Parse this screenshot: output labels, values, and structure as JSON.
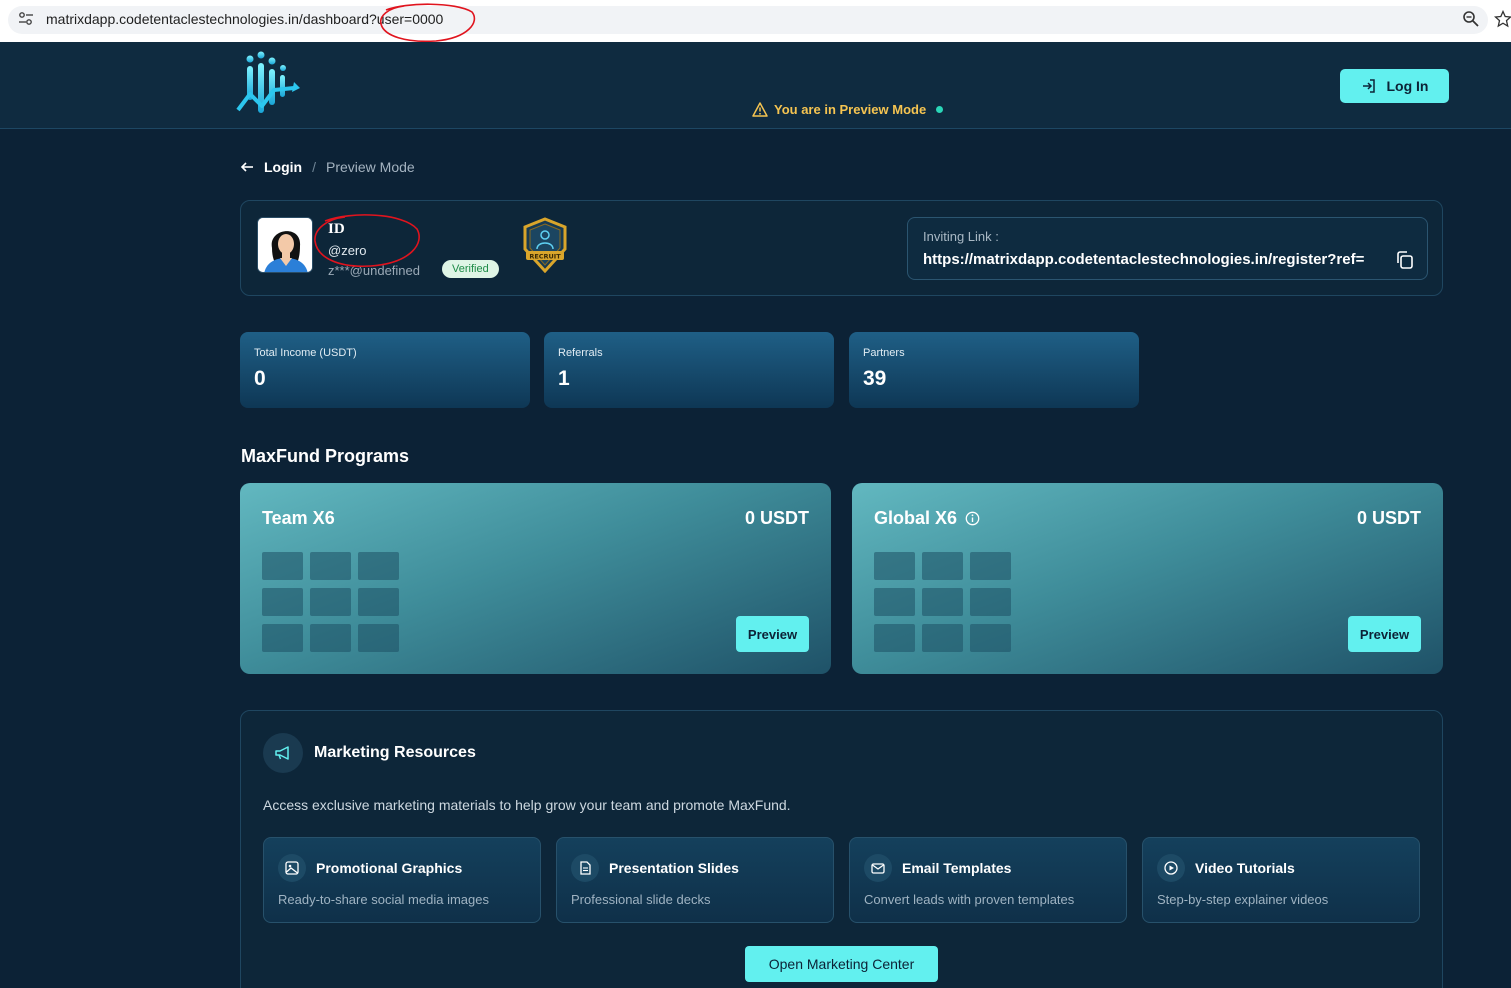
{
  "browser": {
    "url": "matrixdapp.codetentaclestechnologies.in/dashboard?user=0000"
  },
  "header": {
    "preview_notice": "You are in Preview Mode",
    "login_label": "Log In"
  },
  "breadcrumb": {
    "login": "Login",
    "separator": "/",
    "current": "Preview Mode"
  },
  "profile": {
    "id_label": "ID",
    "handle": "@zero",
    "email": "z***@undefined",
    "verified": "Verified",
    "invite_label": "Inviting Link :",
    "invite_link": "https://matrixdapp.codetentaclestechnologies.in/register?ref="
  },
  "stats": [
    {
      "label": "Total Income (USDT)",
      "value": "0"
    },
    {
      "label": "Referrals",
      "value": "1"
    },
    {
      "label": "Partners",
      "value": "39"
    }
  ],
  "programs_title": "MaxFund Programs",
  "programs": [
    {
      "name": "Team X6",
      "amount": "0 USDT",
      "button": "Preview"
    },
    {
      "name": "Global X6",
      "amount": "0 USDT",
      "button": "Preview"
    }
  ],
  "marketing": {
    "title": "Marketing Resources",
    "description": "Access exclusive marketing materials to help grow your team and promote MaxFund.",
    "resources": [
      {
        "title": "Promotional Graphics",
        "subtitle": "Ready-to-share social media images",
        "icon": "image-icon"
      },
      {
        "title": "Presentation Slides",
        "subtitle": "Professional slide decks",
        "icon": "document-icon"
      },
      {
        "title": "Email Templates",
        "subtitle": "Convert leads with proven templates",
        "icon": "mail-icon"
      },
      {
        "title": "Video Tutorials",
        "subtitle": "Step-by-step explainer videos",
        "icon": "play-icon"
      }
    ],
    "button": "Open Marketing Center"
  },
  "colors": {
    "background": "#0c2236",
    "accent": "#62f0ef",
    "warning": "#f5c451",
    "annotation": "#e0141e"
  }
}
